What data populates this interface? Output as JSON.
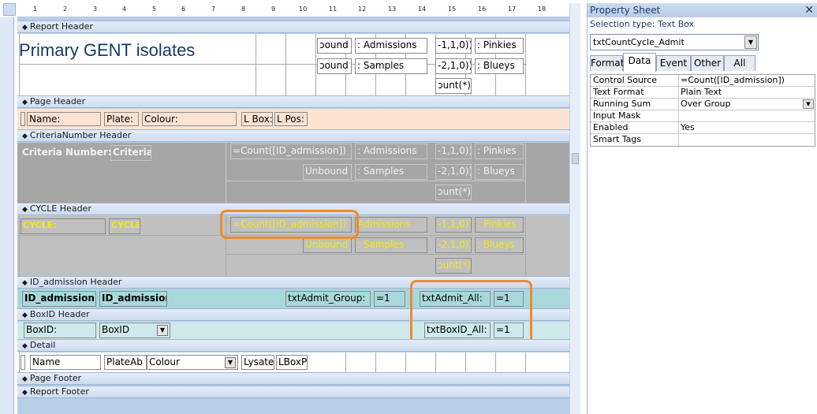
{
  "ruler": {
    "marks": [
      "1",
      "2",
      "3",
      "4",
      "5",
      "6",
      "7",
      "8",
      "9",
      "10",
      "11",
      "12",
      "13",
      "14",
      "15",
      "16",
      "17",
      "18"
    ]
  },
  "sections": {
    "report_header": "Report Header",
    "page_header": "Page Header",
    "criteria_header": "CriteriaNumber Header",
    "cycle_header": "CYCLE Header",
    "idadmission_header": "ID_admission Header",
    "boxid_header": "BoxID Header",
    "detail": "Detail",
    "page_footer": "Page Footer",
    "report_footer": "Report Footer"
  },
  "report_header": {
    "title": "Primary GENT isolates",
    "c1": "ɔound",
    "c2": ": Admissions",
    "c3": "-1,1,0))",
    "c4": ": Pinkies",
    "c5": "ɔound",
    "c6": ": Samples",
    "c7": "-2,1,0))",
    "c8": ": Blueys",
    "c9": "ɔunt(*)"
  },
  "page_header": {
    "name": "Name:",
    "plate": "Plate:",
    "colour": "Colour:",
    "lbox": "L Box:",
    "lpos": "L Pos:"
  },
  "criteria": {
    "label": "Criteria Number:",
    "field": "Criterial",
    "count": "=Count([ID_admission])",
    "c2": ": Admissions",
    "c3": "-1,1,0))",
    "c4": ": Pinkies",
    "unbound": "Unbound",
    "c6": ": Samples",
    "c7": "-2,1,0))",
    "c8": ": Blueys",
    "c9": "ɔunt(*)"
  },
  "cycle": {
    "label": "CYCLE:",
    "field": "CYCLE",
    "count": "=Count([ID_admission])",
    "c2": "Admissions",
    "c3": "-1,1,0))",
    "c4": ": Pinkies",
    "unbound": "Unbound",
    "c6": ": Samples",
    "c7": "-2,1,0))",
    "c8": ": Blueys",
    "c9": "ɔunt(*)"
  },
  "idadm": {
    "label": "ID_admission:",
    "field": "ID_admission",
    "group_label": "txtAdmit_Group:",
    "group_val": "=1",
    "all_label": "txtAdmit_All:",
    "all_val": "=1"
  },
  "boxid": {
    "label": "BoxID:",
    "field": "BoxID",
    "all_label": "txtBoxID_All:",
    "all_val": "=1"
  },
  "detail": {
    "name": "Name",
    "plate": "PlateAb",
    "colour": "Colour",
    "lysate": "Lysate",
    "lbox": "LBoxP"
  },
  "property_sheet": {
    "title": "Property Sheet",
    "selection": "Selection type:  Text Box",
    "object": "txtCountCycle_Admit",
    "tabs": [
      "Format",
      "Data",
      "Event",
      "Other",
      "All"
    ],
    "active_tab": "Data",
    "rows": [
      {
        "k": "Control Source",
        "v": "=Count([ID_admission])"
      },
      {
        "k": "Text Format",
        "v": "Plain Text"
      },
      {
        "k": "Running Sum",
        "v": "Over Group"
      },
      {
        "k": "Input Mask",
        "v": ""
      },
      {
        "k": "Enabled",
        "v": "Yes"
      },
      {
        "k": "Smart Tags",
        "v": ""
      }
    ]
  },
  "colors": {
    "accent": "#ef8a2e",
    "band": "#cddcef",
    "header_fill": "#fbe3d2",
    "group_fill": "#a9d8dc",
    "gray_fill": "#a6a6a6"
  },
  "icons": {
    "section_marker": "section-glyph-icon",
    "dropdown": "chevron-down-icon",
    "close": "close-icon"
  }
}
